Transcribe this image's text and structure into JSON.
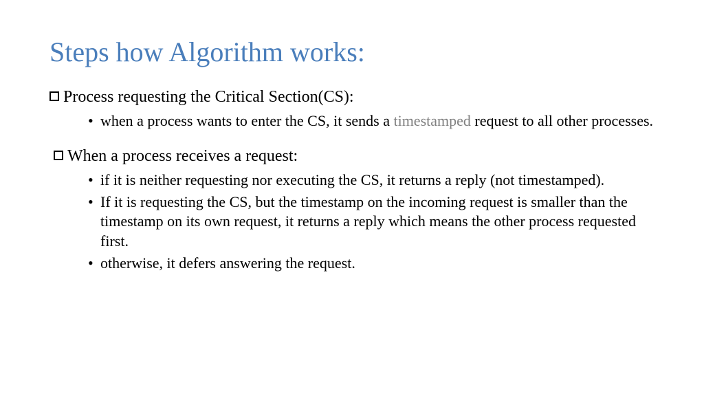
{
  "title": "Steps how Algorithm works:",
  "sections": [
    {
      "header": "Process requesting the Critical Section(CS):",
      "items": [
        {
          "before": "when a process wants to enter the CS, it sends a ",
          "highlight": "timestamped",
          "after": " request to all other processes."
        }
      ]
    },
    {
      "header": "When a process receives a request:",
      "items": [
        {
          "text": "if it is neither requesting nor executing the CS, it returns a reply (not timestamped)."
        },
        {
          "text": "If it is requesting the CS, but the timestamp on the incoming request is smaller than the timestamp on its own request, it returns a reply which means the other process requested first."
        },
        {
          "text": "otherwise, it defers answering the request."
        }
      ]
    }
  ]
}
